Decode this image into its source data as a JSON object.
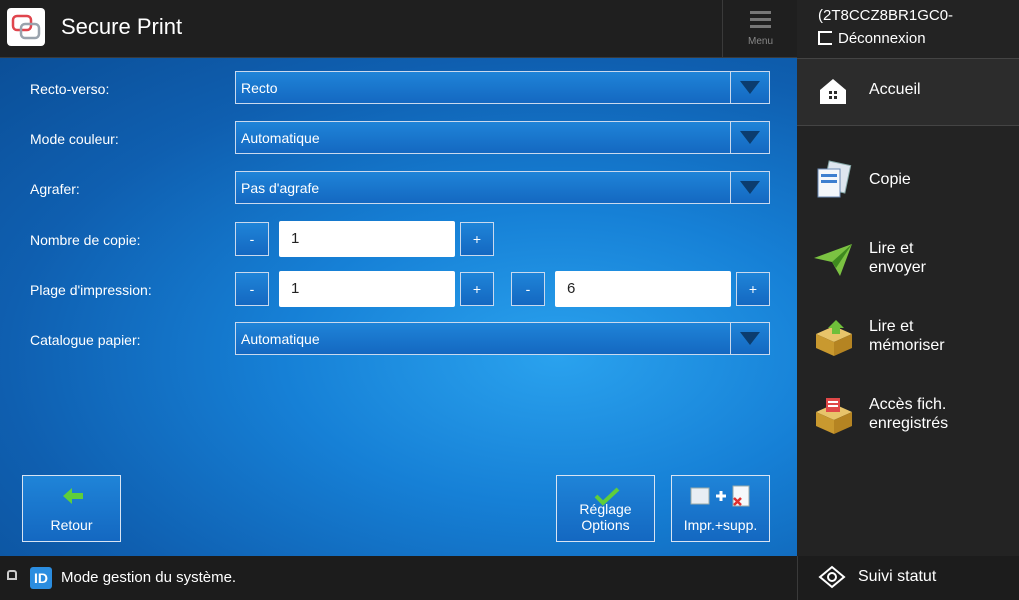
{
  "header": {
    "title": "Secure Print",
    "menu_label": "Menu"
  },
  "user": {
    "id": "(2T8CCZ8BR1GC0-",
    "logout_label": "Déconnexion"
  },
  "side": {
    "home": "Accueil",
    "items": [
      {
        "label1": "Copie",
        "label2": ""
      },
      {
        "label1": "Lire et",
        "label2": "envoyer"
      },
      {
        "label1": "Lire et",
        "label2": "mémoriser"
      },
      {
        "label1": "Accès fich.",
        "label2": "enregistrés"
      }
    ],
    "status": "Suivi statut"
  },
  "form": {
    "duplex": {
      "label": "Recto-verso:",
      "value": "Recto"
    },
    "color": {
      "label": "Mode couleur:",
      "value": "Automatique"
    },
    "staple": {
      "label": "Agrafer:",
      "value": "Pas d'agrafe"
    },
    "copies": {
      "label": "Nombre de copie:",
      "value": "1",
      "minus": "-",
      "plus": "+"
    },
    "range": {
      "label": "Plage d'impression:",
      "from": "1",
      "to": "6",
      "minus": "-",
      "plus": "+"
    },
    "paper": {
      "label": "Catalogue papier:",
      "value": "Automatique"
    }
  },
  "buttons": {
    "back": "Retour",
    "options": "Réglage Options",
    "print_delete": "Impr.+supp."
  },
  "footer": {
    "mode": "Mode gestion du système.",
    "id_badge": "ID"
  }
}
